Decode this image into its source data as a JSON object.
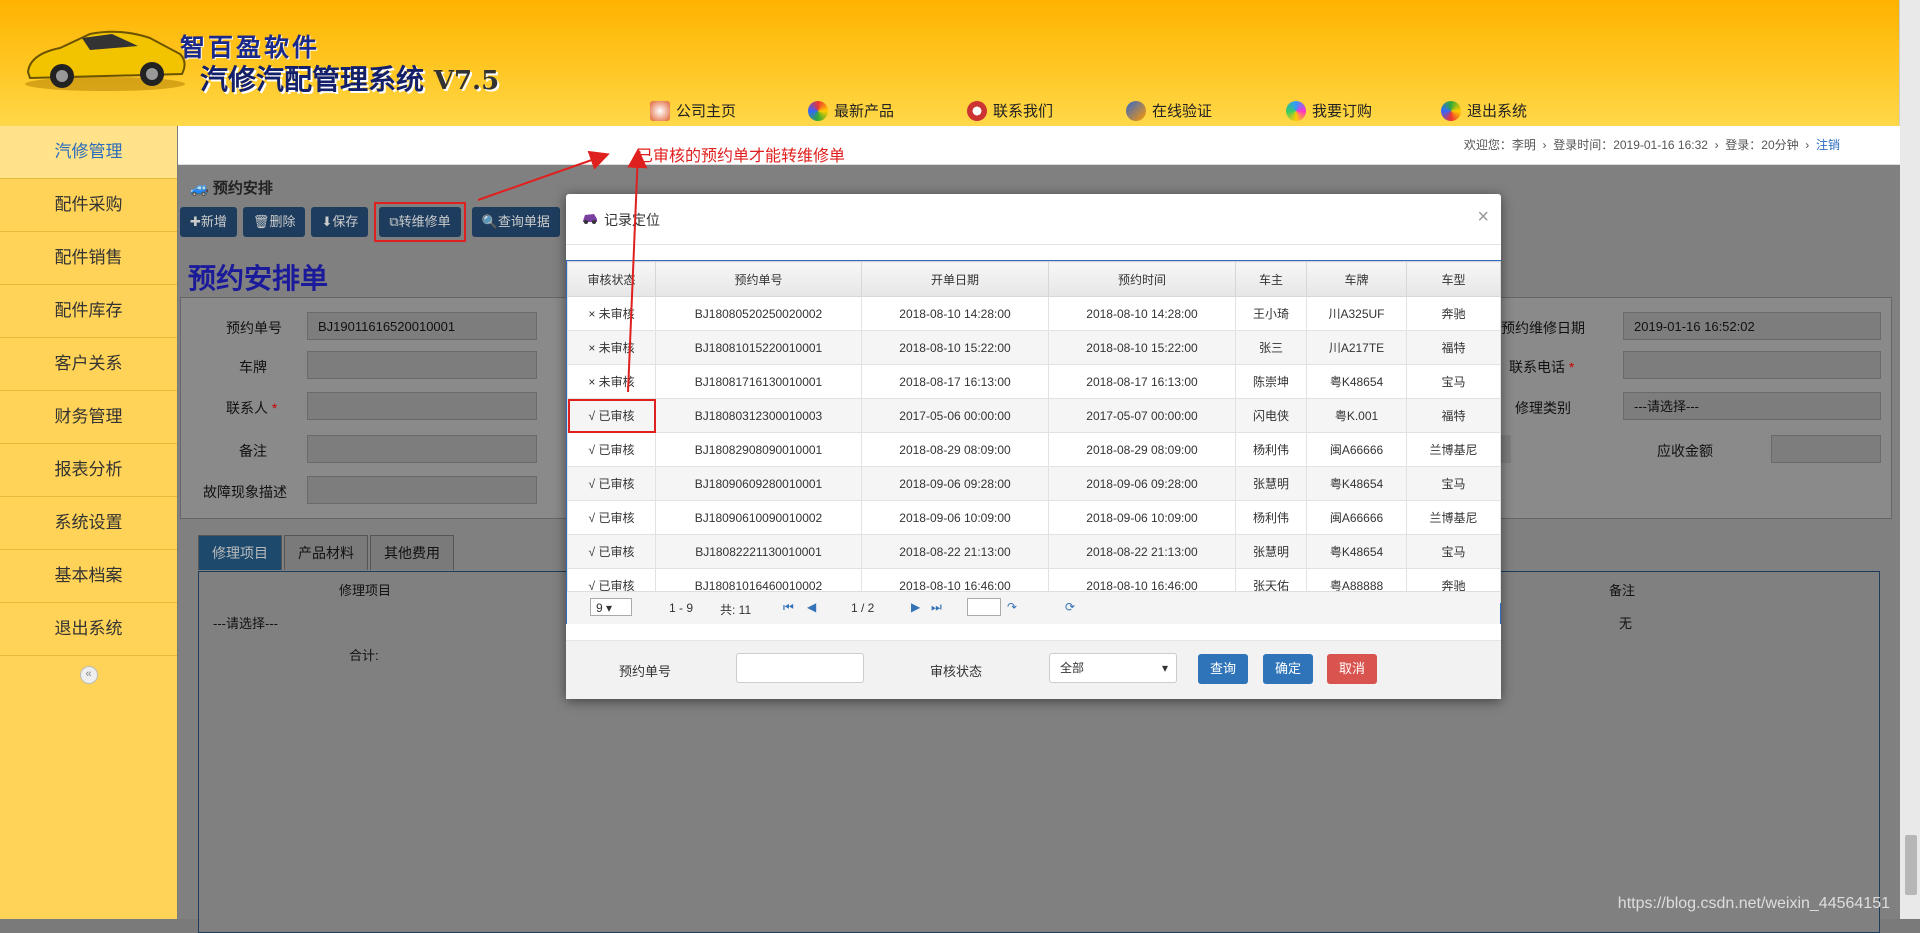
{
  "brand": {
    "line1": "智百盈软件",
    "line2": "汽修汽配管理系统",
    "version": "V7.5"
  },
  "topnav": [
    {
      "label": "公司主页",
      "icon": "home-icon"
    },
    {
      "label": "最新产品",
      "icon": "products-icon"
    },
    {
      "label": "联系我们",
      "icon": "contact-icon"
    },
    {
      "label": "在线验证",
      "icon": "verify-icon"
    },
    {
      "label": "我要订购",
      "icon": "order-icon"
    },
    {
      "label": "退出系统",
      "icon": "exit-icon"
    }
  ],
  "sidebar": {
    "items": [
      "汽修管理",
      "配件采购",
      "配件销售",
      "配件库存",
      "客户关系",
      "财务管理",
      "报表分析",
      "系统设置",
      "基本档案",
      "退出系统"
    ],
    "active": "汽修管理"
  },
  "infobar": {
    "welcome": "欢迎您：李明",
    "login_time": "登录时间：2019-01-16 16:32",
    "login_duration": "登录：20分钟",
    "logout": "注销"
  },
  "annotation": "已审核的预约单才能转维修单",
  "page": {
    "section_title": "预约安排",
    "toolbar": {
      "new": "新增",
      "delete": "删除",
      "save": "保存",
      "convert": "转维修单",
      "query": "查询单据"
    },
    "form_title": "预约安排单",
    "fields": {
      "order_no_label": "预约单号",
      "order_no_value": "BJ19011616520010001",
      "plate_label": "车牌",
      "contact_label": "联系人",
      "remark_label": "备注",
      "fault_label": "故障现象描述",
      "repair_date_label": "预约维修日期",
      "repair_date_value": "2019-01-16 16:52:02",
      "phone_label": "联系电话",
      "repair_type_label": "修理类别",
      "repair_type_value": "---请选择---",
      "receivable_label": "应收金额"
    },
    "tabs": [
      "修理项目",
      "产品材料",
      "其他费用"
    ],
    "grid": {
      "col_item": "修理项目",
      "col_remark": "备注",
      "select_placeholder": "---请选择---",
      "remark_value": "无",
      "total_label": "合计:"
    }
  },
  "modal": {
    "title": "记录定位",
    "close": "×",
    "columns": [
      "审核状态",
      "预约单号",
      "开单日期",
      "预约时间",
      "车主",
      "车牌",
      "车型"
    ],
    "rows": [
      {
        "status": "× 未审核",
        "approved": false,
        "no": "BJ18080520250020002",
        "open": "2018-08-10 14:28:00",
        "appt": "2018-08-10 14:28:00",
        "owner": "王小琦",
        "plate": "川A325UF",
        "model": "奔驰"
      },
      {
        "status": "× 未审核",
        "approved": false,
        "no": "BJ18081015220010001",
        "open": "2018-08-10 15:22:00",
        "appt": "2018-08-10 15:22:00",
        "owner": "张三",
        "plate": "川A217TE",
        "model": "福特"
      },
      {
        "status": "× 未审核",
        "approved": false,
        "no": "BJ18081716130010001",
        "open": "2018-08-17 16:13:00",
        "appt": "2018-08-17 16:13:00",
        "owner": "陈崇坤",
        "plate": "粤K48654",
        "model": "宝马"
      },
      {
        "status": "√ 已审核",
        "approved": true,
        "no": "BJ18080312300010003",
        "open": "2017-05-06 00:00:00",
        "appt": "2017-05-07 00:00:00",
        "owner": "闪电侠",
        "plate": "粤K.001",
        "model": "福特"
      },
      {
        "status": "√ 已审核",
        "approved": true,
        "no": "BJ18082908090010001",
        "open": "2018-08-29 08:09:00",
        "appt": "2018-08-29 08:09:00",
        "owner": "杨利伟",
        "plate": "闽A66666",
        "model": "兰博基尼"
      },
      {
        "status": "√ 已审核",
        "approved": true,
        "no": "BJ18090609280010001",
        "open": "2018-09-06 09:28:00",
        "appt": "2018-09-06 09:28:00",
        "owner": "张慧明",
        "plate": "粤K48654",
        "model": "宝马"
      },
      {
        "status": "√ 已审核",
        "approved": true,
        "no": "BJ18090610090010002",
        "open": "2018-09-06 10:09:00",
        "appt": "2018-09-06 10:09:00",
        "owner": "杨利伟",
        "plate": "闽A66666",
        "model": "兰博基尼"
      },
      {
        "status": "√ 已审核",
        "approved": true,
        "no": "BJ18082221130010001",
        "open": "2018-08-22 21:13:00",
        "appt": "2018-08-22 21:13:00",
        "owner": "张慧明",
        "plate": "粤K48654",
        "model": "宝马"
      },
      {
        "status": "√ 已审核",
        "approved": true,
        "no": "BJ18081016460010002",
        "open": "2018-08-10 16:46:00",
        "appt": "2018-08-10 16:46:00",
        "owner": "张天佑",
        "plate": "粤A88888",
        "model": "奔驰"
      }
    ],
    "pager": {
      "page_size": "9",
      "range": "1 - 9",
      "total": "共: 11",
      "page": "1 / 2"
    },
    "footer": {
      "order_no_label": "预约单号",
      "status_label": "审核状态",
      "status_value": "全部",
      "query": "查询",
      "confirm": "确定",
      "cancel": "取消"
    }
  },
  "watermark": "https://blog.csdn.net/weixin_44564151"
}
